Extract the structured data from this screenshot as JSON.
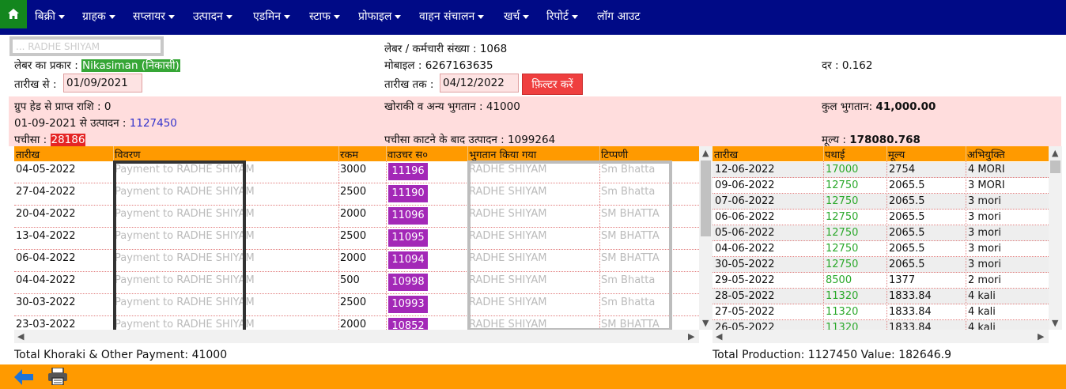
{
  "nav": {
    "items": [
      {
        "label": "बिक्री",
        "caret": true
      },
      {
        "label": "ग्राहक",
        "caret": true
      },
      {
        "label": "सप्लायर",
        "caret": true
      },
      {
        "label": "उत्पादन",
        "caret": true
      },
      {
        "label": "एडमिन",
        "caret": true
      },
      {
        "label": "स्टाफ",
        "caret": true
      },
      {
        "label": "प्रोफाइल",
        "caret": true
      },
      {
        "label": "वाहन संचालन",
        "caret": true
      },
      {
        "label": "खर्च",
        "caret": true
      },
      {
        "label": "रिपोर्ट",
        "caret": true
      },
      {
        "label": "लॉग आउट",
        "caret": false
      }
    ],
    "home_icon": "home-icon"
  },
  "info": {
    "name_masked": "... RADHE SHIYAM",
    "labour_type_label": "लेबर का प्रकार :",
    "labour_type_value": "Nikasiman (निकासी)",
    "date_from_label": "तारीख से :",
    "date_from_value": "01/09/2021",
    "labour_id_label": "लेबर / कर्मचारी संख्या :",
    "labour_id_value": "1068",
    "mobile_label": "मोबाइल :",
    "mobile_value": "6267163635",
    "date_to_label": "तारीख तक :",
    "date_to_value": "04/12/2022",
    "filter_button": "फ़िल्टर करें",
    "rate_label": "दर :",
    "rate_value": "0.162"
  },
  "summary": {
    "group_head_label": "ग्रुप हेड से प्राप्त राशि :",
    "group_head_value": "0",
    "production_from_label": "01-09-2021 से उत्पादन :",
    "production_from_value": "1127450",
    "pachisa_label": "पचीसा :",
    "pachisa_value": "28186",
    "khoraki_label": "खोराकी व अन्य भुगतान :",
    "khoraki_value": "41000",
    "after_pachisa_label": "पचीसा काटने के बाद उत्पादन :",
    "after_pachisa_value": "1099264",
    "total_payment_label": "कुल भुगतान:",
    "total_payment_value": "41,000.00",
    "price_label": "मूल्य :",
    "price_value": "178080.768"
  },
  "payments": {
    "headers": [
      "तारीख",
      "विवरण",
      "रकम",
      "वाउचर स०",
      "भुगतान किया गया",
      "टिप्पणी"
    ],
    "rows": [
      {
        "date": "04-05-2022",
        "desc": "Payment to RADHE SHIYAM",
        "amount": "3000",
        "voucher": "11196",
        "paid_to": "RADHE SHIYAM",
        "note": "Sm Bhatta"
      },
      {
        "date": "27-04-2022",
        "desc": "Payment to RADHE SHIYAM",
        "amount": "2500",
        "voucher": "11190",
        "paid_to": "RADHE SHIYAM",
        "note": "Sm Bhatta"
      },
      {
        "date": "20-04-2022",
        "desc": "Payment to RADHE SHIYAM",
        "amount": "2000",
        "voucher": "11096",
        "paid_to": "RADHE SHIYAM",
        "note": "SM BHATTA"
      },
      {
        "date": "13-04-2022",
        "desc": "Payment to RADHE SHIYAM",
        "amount": "2500",
        "voucher": "11095",
        "paid_to": "RADHE SHIYAM",
        "note": "SM BHATTA"
      },
      {
        "date": "06-04-2022",
        "desc": "Payment to RADHE SHIYAM",
        "amount": "2000",
        "voucher": "11094",
        "paid_to": "RADHE SHIYAM",
        "note": "SM BHATTA"
      },
      {
        "date": "04-04-2022",
        "desc": "Payment to RADHE SHIYAM",
        "amount": "500",
        "voucher": "10998",
        "paid_to": "RADHE SHIYAM",
        "note": "Sm Bhatta"
      },
      {
        "date": "30-03-2022",
        "desc": "Payment to RADHE SHIYAM",
        "amount": "2500",
        "voucher": "10993",
        "paid_to": "RADHE SHIYAM",
        "note": "Sm Bhatta"
      },
      {
        "date": "23-03-2022",
        "desc": "Payment to RADHE SHIYAM",
        "amount": "2000",
        "voucher": "10852",
        "paid_to": "RADHE SHIYAM",
        "note": "SM BHATTA"
      }
    ],
    "footer_total": "Total Khoraki & Other Payment: 41000"
  },
  "production": {
    "headers": [
      "तारीख",
      "पथाई",
      "मूल्य",
      "अभियुक्ति"
    ],
    "rows": [
      {
        "date": "12-06-2022",
        "pathai": "17000",
        "value": "2754",
        "remark": "4 MORI"
      },
      {
        "date": "09-06-2022",
        "pathai": "12750",
        "value": "2065.5",
        "remark": "3 MORI"
      },
      {
        "date": "07-06-2022",
        "pathai": "12750",
        "value": "2065.5",
        "remark": "3 mori"
      },
      {
        "date": "06-06-2022",
        "pathai": "12750",
        "value": "2065.5",
        "remark": "3 mori"
      },
      {
        "date": "05-06-2022",
        "pathai": "12750",
        "value": "2065.5",
        "remark": "3 mori"
      },
      {
        "date": "04-06-2022",
        "pathai": "12750",
        "value": "2065.5",
        "remark": "3 mori"
      },
      {
        "date": "30-05-2022",
        "pathai": "12750",
        "value": "2065.5",
        "remark": "3 mori"
      },
      {
        "date": "29-05-2022",
        "pathai": "8500",
        "value": "1377",
        "remark": "2 mori"
      },
      {
        "date": "28-05-2022",
        "pathai": "11320",
        "value": "1833.84",
        "remark": "4 kali"
      },
      {
        "date": "27-05-2022",
        "pathai": "11320",
        "value": "1833.84",
        "remark": "4 kali"
      },
      {
        "date": "26-05-2022",
        "pathai": "11320",
        "value": "1833.84",
        "remark": "4 kali"
      }
    ],
    "footer_total": "Total Production: 1127450 Value: 182646.9"
  },
  "footer": {
    "back_icon": "back-arrow-icon",
    "print_icon": "printer-icon"
  }
}
